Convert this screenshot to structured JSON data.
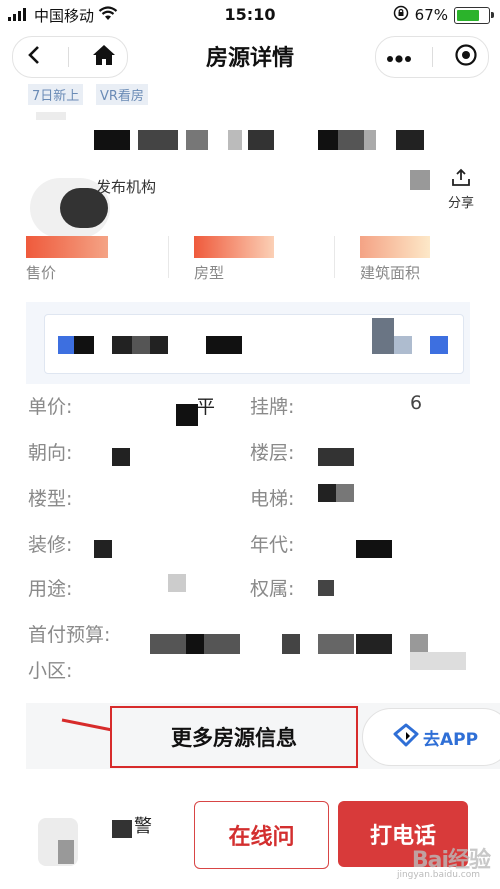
{
  "status_bar": {
    "carrier": "中国移动",
    "time": "15:10",
    "battery_percent": "67%"
  },
  "nav": {
    "title": "房源详情"
  },
  "tags": [
    "7日新上",
    "VR看房"
  ],
  "header": {
    "partial_text": "发布机构",
    "share_label": "分享"
  },
  "stats": [
    {
      "label": "售价"
    },
    {
      "label": "房型"
    },
    {
      "label": "建筑面积"
    }
  ],
  "details": {
    "left": [
      {
        "label": "单价:",
        "value_fragment": "平"
      },
      {
        "label": "朝向:"
      },
      {
        "label": "楼型:"
      },
      {
        "label": "装修:"
      },
      {
        "label": "用途:"
      }
    ],
    "right": [
      {
        "label": "挂牌:",
        "value_fragment": "6"
      },
      {
        "label": "楼层:"
      },
      {
        "label": "电梯:"
      },
      {
        "label": "年代:"
      },
      {
        "label": "权属:"
      }
    ],
    "down_payment_label": "首付预算:",
    "community_label": "小区:"
  },
  "more_button": "更多房源信息",
  "go_app": "去APP",
  "agent": {
    "name_fragment": "警"
  },
  "buttons": {
    "online": "在线问",
    "call": "打电话"
  },
  "watermark": {
    "brand": "Bai经验",
    "url": "jingyan.baidu.com"
  },
  "colors": {
    "accent_red": "#d83a3a",
    "tag_blue": "#6a8bb6",
    "app_blue": "#2f6fd6"
  }
}
